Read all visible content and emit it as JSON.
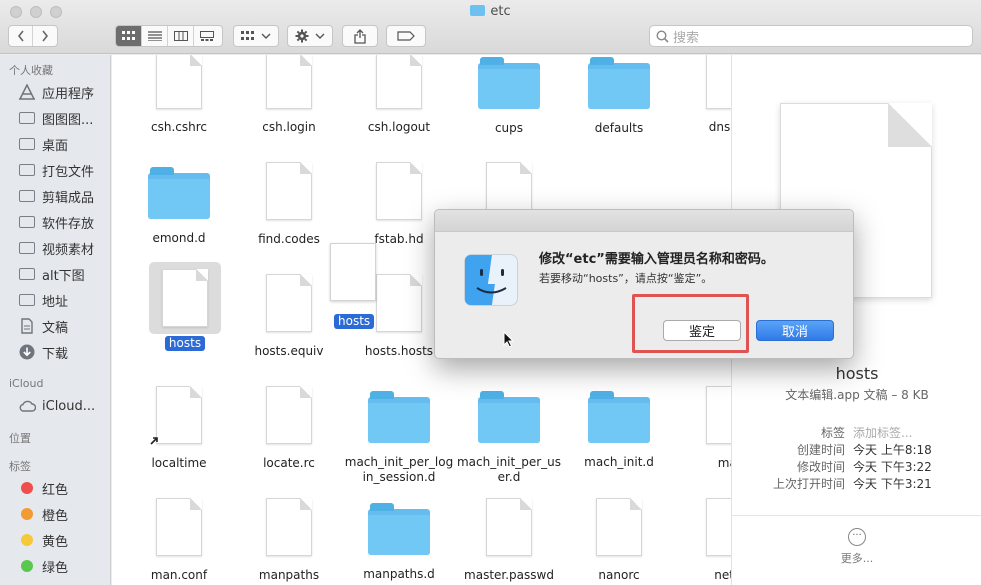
{
  "window": {
    "title": "etc"
  },
  "toolbar": {
    "back_icon": "chevron-left-icon",
    "forward_icon": "chevron-right-icon",
    "view_modes": [
      "icon-view-icon",
      "list-view-icon",
      "column-view-icon",
      "gallery-view-icon"
    ],
    "active_view": 0,
    "search_placeholder": "搜索"
  },
  "sidebar": {
    "favorites_header": "个人收藏",
    "favorites": [
      "应用程序",
      "图图图...",
      "桌面",
      "打包文件",
      "剪辑成品",
      "软件存放",
      "视频素材",
      "alt下图",
      "地址",
      "文稿",
      "下载"
    ],
    "icloud_header": "iCloud",
    "icloud_items": [
      "iCloud..."
    ],
    "locations_header": "位置",
    "tags_header": "标签",
    "tags": [
      {
        "name": "红色",
        "color": "#ef4e4c"
      },
      {
        "name": "橙色",
        "color": "#f49a32"
      },
      {
        "name": "黄色",
        "color": "#f5c93a"
      },
      {
        "name": "绿色",
        "color": "#5ac74f"
      }
    ]
  },
  "files": [
    {
      "name": "csh.cshrc",
      "kind": "doc"
    },
    {
      "name": "csh.login",
      "kind": "doc"
    },
    {
      "name": "csh.logout",
      "kind": "doc"
    },
    {
      "name": "cups",
      "kind": "folder"
    },
    {
      "name": "defaults",
      "kind": "folder"
    },
    {
      "name": "dnsext",
      "kind": "doc"
    },
    {
      "name": "emond.d",
      "kind": "folder"
    },
    {
      "name": "find.codes",
      "kind": "doc"
    },
    {
      "name": "fstab.hd",
      "kind": "doc"
    },
    {
      "name": "hosts",
      "kind": "doc",
      "selected": true
    },
    {
      "name": "hosts.equiv",
      "kind": "doc"
    },
    {
      "name": "hosts.hosts",
      "kind": "doc"
    },
    {
      "name": "localtime",
      "kind": "doc"
    },
    {
      "name": "locate.rc",
      "kind": "doc"
    },
    {
      "name": "mach_init_per_login_session.d",
      "display": "mach_init_per_log\nin_session.d",
      "kind": "folder"
    },
    {
      "name": "mach_init_per_user.d",
      "display": "mach_init_per_us\ner.d",
      "kind": "folder"
    },
    {
      "name": "mach_init.d",
      "kind": "folder"
    },
    {
      "name": "mai",
      "kind": "doc"
    },
    {
      "name": "man.conf",
      "kind": "doc"
    },
    {
      "name": "manpaths",
      "kind": "doc"
    },
    {
      "name": "manpaths.d",
      "kind": "folder"
    },
    {
      "name": "master.passwd",
      "kind": "doc"
    },
    {
      "name": "nanorc",
      "kind": "doc"
    },
    {
      "name": "netw",
      "kind": "doc"
    }
  ],
  "drag_ghost": {
    "label": "hosts"
  },
  "preview": {
    "name": "hosts",
    "kind": "文本编辑.app 文稿 – 8 KB",
    "rows": [
      {
        "key": "标签",
        "value": "添加标签...",
        "placeholder": true
      },
      {
        "key": "创建时间",
        "value": "今天 上午8:18"
      },
      {
        "key": "修改时间",
        "value": "今天 下午3:22"
      },
      {
        "key": "上次打开时间",
        "value": "今天 下午3:21"
      }
    ],
    "more_label": "更多..."
  },
  "dialog": {
    "title": "修改“etc”需要输入管理员名称和密码。",
    "message": "若要移动“hosts”，请点按“鉴定”。",
    "authenticate_label": "鉴定",
    "cancel_label": "取消"
  }
}
